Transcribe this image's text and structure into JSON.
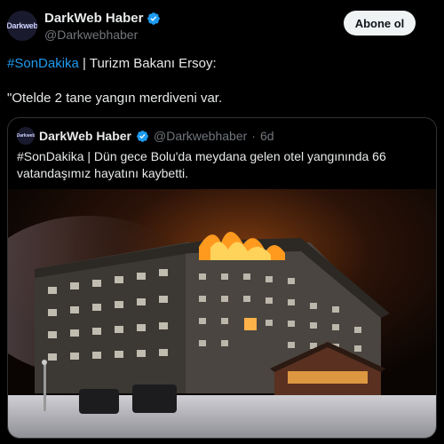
{
  "tweet": {
    "author_name": "DarkWeb Haber",
    "author_handle": "@Darkwebhaber",
    "avatar_text": "Darkweb",
    "follow_label": "Abone ol",
    "line1_hashtag": "#SonDakika",
    "line1_rest": " | Turizm Bakanı Ersoy:",
    "line2": "\"Otelde 2 tane yangın merdiveni var."
  },
  "quote": {
    "author_name": "DarkWeb Haber",
    "author_handle": "@Darkwebhaber",
    "separator": "·",
    "time": "6d",
    "text_hashtag": "#SonDakika",
    "text_rest": " | Dün gece Bolu'da meydana gelen otel yangınında 66 vatandaşımız hayatını kaybetti."
  },
  "colors": {
    "background": "#000000",
    "link_blue": "#1d9bf0",
    "verified_blue": "#1d9bf0",
    "muted_text": "#71767b",
    "border": "#2f3336"
  },
  "icons": {
    "verified": "verified-badge-icon"
  }
}
